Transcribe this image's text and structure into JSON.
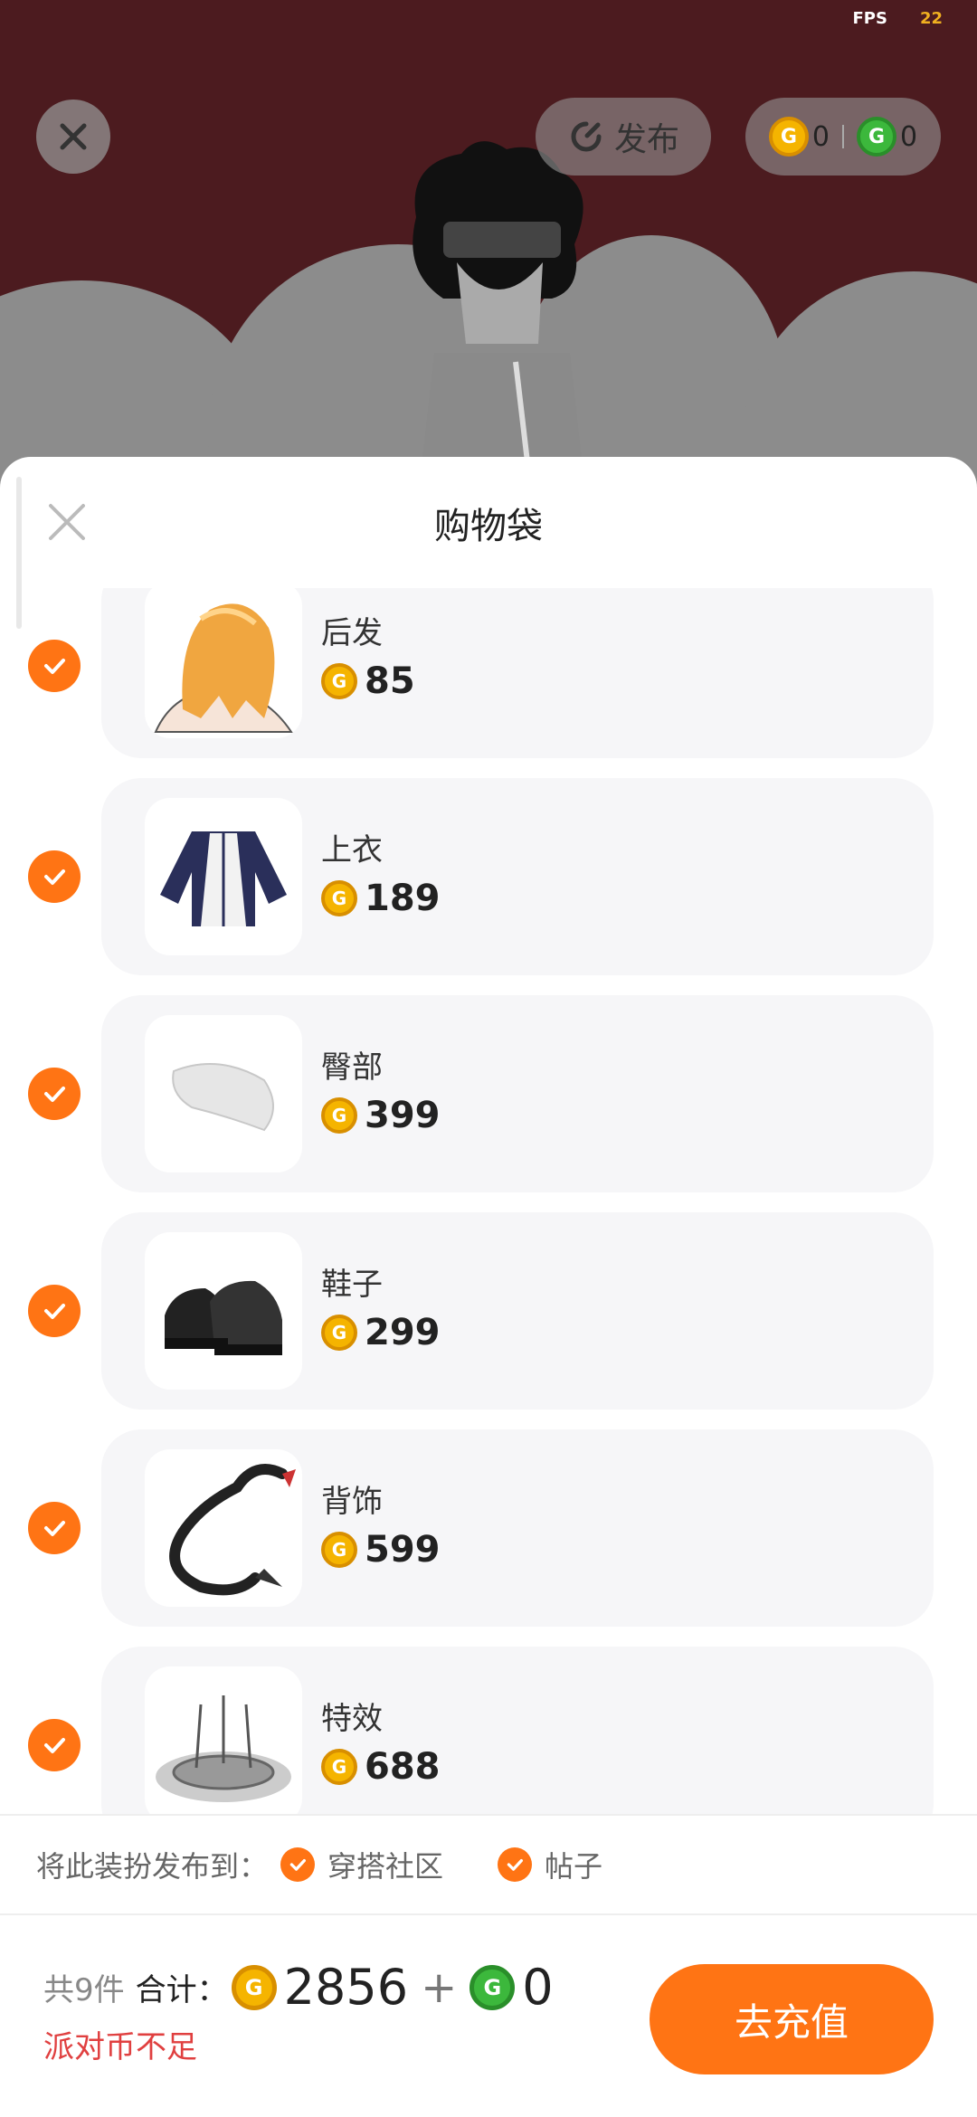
{
  "scene": {
    "fps_label": "FPS",
    "fps_value": "22",
    "publish_label": "发布",
    "gold_balance": "0",
    "green_balance": "0"
  },
  "sheet": {
    "title": "购物袋",
    "items": [
      {
        "name": "后发",
        "price": "85",
        "thumb": "hair-thumbnail"
      },
      {
        "name": "上衣",
        "price": "189",
        "thumb": "jacket-thumbnail"
      },
      {
        "name": "臀部",
        "price": "399",
        "thumb": "tail-thumbnail"
      },
      {
        "name": "鞋子",
        "price": "299",
        "thumb": "shoes-thumbnail"
      },
      {
        "name": "背饰",
        "price": "599",
        "thumb": "dragon-thumbnail"
      },
      {
        "name": "特效",
        "price": "688",
        "thumb": "effect-thumbnail"
      }
    ]
  },
  "publish": {
    "label": "将此装扮发布到：",
    "option1": "穿搭社区",
    "option2": "帖子"
  },
  "footer": {
    "count": "共9件",
    "sum_label": "合计：",
    "gold_total": "2856",
    "plus": "+",
    "green_total": "0",
    "warning": "派对币不足",
    "recharge_label": "去充值"
  },
  "colors": {
    "accent": "#ff7414",
    "coin_gold": "#f5b400",
    "coin_green": "#3cb83c",
    "warning": "#e04040",
    "scene_bg": "#4c1b1f"
  }
}
